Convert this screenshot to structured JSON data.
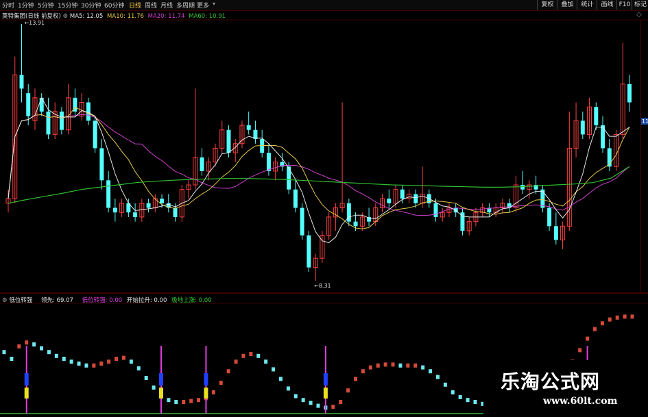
{
  "toolbar": {
    "periods": [
      "分时",
      "1分钟",
      "5分钟",
      "15分钟",
      "30分钟",
      "60分钟",
      "日线",
      "周线",
      "月线",
      "多周期",
      "更多"
    ],
    "active_period": "日线",
    "right_buttons": [
      "复权",
      "叠加",
      "统计",
      "画线",
      "F10",
      "标记"
    ]
  },
  "main_legend": {
    "stock_label": "英特集团(日线 前复权)",
    "ma5": "MA5: 12.05",
    "ma10": "MA10: 11.76",
    "ma20": "MA20: 11.74",
    "ma60": "MA60: 10.91",
    "colors": {
      "ma5": "#e8e8e8",
      "ma10": "#e8c84a",
      "ma20": "#d040d0",
      "ma60": "#30c030"
    }
  },
  "indicator_legend": {
    "name": "低位转强",
    "items": [
      {
        "label": "领先: 69.07",
        "color": "#e0e0e0"
      },
      {
        "label": "低位转强: 0.00",
        "color": "#e040e0"
      },
      {
        "label": "开始拉升: 0.00",
        "color": "#e0e0e0"
      },
      {
        "label": "极地上涨: 0.00",
        "color": "#30d030"
      }
    ]
  },
  "chart_data": {
    "type": "candlestick",
    "annotations": {
      "high_label": "13.91",
      "low_label": "8.31",
      "right_tick": "11"
    },
    "ma60": [
      10.0,
      10.08,
      10.15,
      10.22,
      10.3,
      10.35,
      10.4,
      10.45,
      10.48,
      10.5,
      10.52,
      10.53,
      10.54,
      10.54,
      10.53,
      10.52,
      10.5,
      10.48,
      10.46,
      10.44,
      10.42,
      10.4,
      10.39,
      10.38,
      10.37,
      10.36,
      10.35,
      10.35,
      10.36,
      10.38,
      10.4,
      10.42,
      10.45,
      10.55,
      10.8
    ],
    "ohlc": [
      [
        10.0,
        10.3,
        9.8,
        10.1
      ],
      [
        10.1,
        13.2,
        10.0,
        12.8
      ],
      [
        12.8,
        13.91,
        12.2,
        12.5
      ],
      [
        12.4,
        12.6,
        11.7,
        11.9
      ],
      [
        11.8,
        12.5,
        11.6,
        12.3
      ],
      [
        12.3,
        12.4,
        11.9,
        12.0
      ],
      [
        12.0,
        12.3,
        11.4,
        11.5
      ],
      [
        11.5,
        12.2,
        11.4,
        12.0
      ],
      [
        12.0,
        12.1,
        11.5,
        11.6
      ],
      [
        11.6,
        12.6,
        11.5,
        12.3
      ],
      [
        12.3,
        12.5,
        11.9,
        12.0
      ],
      [
        11.9,
        12.4,
        11.8,
        12.2
      ],
      [
        12.2,
        12.3,
        11.7,
        11.8
      ],
      [
        11.8,
        11.9,
        11.1,
        11.2
      ],
      [
        11.2,
        11.4,
        10.3,
        10.5
      ],
      [
        10.5,
        10.7,
        9.8,
        9.9
      ],
      [
        9.9,
        10.1,
        9.6,
        9.8
      ],
      [
        9.8,
        10.1,
        9.7,
        10.0
      ],
      [
        10.0,
        10.1,
        9.7,
        9.8
      ],
      [
        9.8,
        10.0,
        9.6,
        9.7
      ],
      [
        9.7,
        10.1,
        9.6,
        10.0
      ],
      [
        10.0,
        10.1,
        9.8,
        9.9
      ],
      [
        9.9,
        10.2,
        9.8,
        10.1
      ],
      [
        10.1,
        10.2,
        9.9,
        10.0
      ],
      [
        10.0,
        10.2,
        9.8,
        9.9
      ],
      [
        9.9,
        10.0,
        9.6,
        9.7
      ],
      [
        9.7,
        10.4,
        9.6,
        10.3
      ],
      [
        10.3,
        10.5,
        10.1,
        10.4
      ],
      [
        10.4,
        12.5,
        10.3,
        11.0
      ],
      [
        11.0,
        11.2,
        10.6,
        10.7
      ],
      [
        10.7,
        11.0,
        10.5,
        10.9
      ],
      [
        10.9,
        11.3,
        10.8,
        11.2
      ],
      [
        11.2,
        11.8,
        11.1,
        11.6
      ],
      [
        11.6,
        11.7,
        11.0,
        11.1
      ],
      [
        11.1,
        11.4,
        10.9,
        11.3
      ],
      [
        11.3,
        11.8,
        11.2,
        11.7
      ],
      [
        11.7,
        12.0,
        11.5,
        11.6
      ],
      [
        11.6,
        11.8,
        11.3,
        11.4
      ],
      [
        11.4,
        11.6,
        11.0,
        11.1
      ],
      [
        11.1,
        11.3,
        10.6,
        10.7
      ],
      [
        10.7,
        11.0,
        10.5,
        10.9
      ],
      [
        10.9,
        11.1,
        10.7,
        10.8
      ],
      [
        10.8,
        10.9,
        10.2,
        10.3
      ],
      [
        10.3,
        10.5,
        9.8,
        9.9
      ],
      [
        9.9,
        10.0,
        9.2,
        9.3
      ],
      [
        9.3,
        9.4,
        8.5,
        8.6
      ],
      [
        8.6,
        8.9,
        8.31,
        8.8
      ],
      [
        8.8,
        9.4,
        8.7,
        9.3
      ],
      [
        9.3,
        9.8,
        9.2,
        9.7
      ],
      [
        9.7,
        10.0,
        9.4,
        9.9
      ],
      [
        9.9,
        12.2,
        9.8,
        10.0
      ],
      [
        10.0,
        10.1,
        9.5,
        9.6
      ],
      [
        9.6,
        9.8,
        9.4,
        9.5
      ],
      [
        9.5,
        9.8,
        9.4,
        9.7
      ],
      [
        9.7,
        9.9,
        9.5,
        9.6
      ],
      [
        9.6,
        10.0,
        9.5,
        9.9
      ],
      [
        9.9,
        10.2,
        9.8,
        10.1
      ],
      [
        10.1,
        10.3,
        9.9,
        10.0
      ],
      [
        10.0,
        10.4,
        9.9,
        10.3
      ],
      [
        10.3,
        10.4,
        10.0,
        10.1
      ],
      [
        10.1,
        10.3,
        10.0,
        10.2
      ],
      [
        10.2,
        10.3,
        9.9,
        10.0
      ],
      [
        10.0,
        10.8,
        9.9,
        10.2
      ],
      [
        10.2,
        10.3,
        9.9,
        10.0
      ],
      [
        10.0,
        10.1,
        9.6,
        9.7
      ],
      [
        9.7,
        9.9,
        9.6,
        9.8
      ],
      [
        9.8,
        10.0,
        9.7,
        9.9
      ],
      [
        9.9,
        10.0,
        9.7,
        9.8
      ],
      [
        9.8,
        9.9,
        9.3,
        9.4
      ],
      [
        9.4,
        9.7,
        9.3,
        9.6
      ],
      [
        9.6,
        9.9,
        9.5,
        9.8
      ],
      [
        9.8,
        10.0,
        9.7,
        9.9
      ],
      [
        9.9,
        10.0,
        9.7,
        9.8
      ],
      [
        9.8,
        10.0,
        9.7,
        9.9
      ],
      [
        9.9,
        10.1,
        9.8,
        10.0
      ],
      [
        10.0,
        10.1,
        9.8,
        9.9
      ],
      [
        9.9,
        10.6,
        9.8,
        10.4
      ],
      [
        10.4,
        10.7,
        10.2,
        10.3
      ],
      [
        10.3,
        10.5,
        10.1,
        10.4
      ],
      [
        10.4,
        10.6,
        10.2,
        10.3
      ],
      [
        10.3,
        10.4,
        9.8,
        9.9
      ],
      [
        9.9,
        10.0,
        9.4,
        9.5
      ],
      [
        9.5,
        9.8,
        9.1,
        9.2
      ],
      [
        9.2,
        9.6,
        9.0,
        9.5
      ],
      [
        9.5,
        12.0,
        9.4,
        11.2
      ],
      [
        11.2,
        12.2,
        11.0,
        11.8
      ],
      [
        11.8,
        12.0,
        11.4,
        11.5
      ],
      [
        11.5,
        12.3,
        11.4,
        12.1
      ],
      [
        12.1,
        12.2,
        11.6,
        11.7
      ],
      [
        11.7,
        11.9,
        11.1,
        11.2
      ],
      [
        11.2,
        11.4,
        10.7,
        10.8
      ],
      [
        10.8,
        11.6,
        10.7,
        11.5
      ],
      [
        11.5,
        13.5,
        11.4,
        12.6
      ],
      [
        12.6,
        12.8,
        12.0,
        12.2
      ]
    ],
    "indicator": {
      "range": [
        0,
        100
      ],
      "values": [
        62,
        55,
        68,
        72,
        70,
        66,
        62,
        58,
        55,
        52,
        50,
        48,
        48,
        50,
        52,
        55,
        56,
        52,
        45,
        35,
        25,
        16,
        12,
        10,
        10,
        11,
        12,
        14,
        20,
        30,
        42,
        52,
        58,
        60,
        58,
        52,
        44,
        34,
        24,
        16,
        12,
        9,
        6,
        4,
        5,
        10,
        22,
        34,
        42,
        46,
        48,
        49,
        49,
        48,
        48,
        48,
        46,
        42,
        36,
        28,
        20,
        15,
        12,
        10,
        8,
        7,
        8,
        10,
        12,
        16,
        22,
        28,
        30,
        32,
        34,
        40,
        52,
        64,
        76,
        86,
        92,
        96,
        98,
        99,
        99
      ],
      "signal_markers": [
        3,
        21,
        27,
        43,
        78
      ]
    }
  }
}
